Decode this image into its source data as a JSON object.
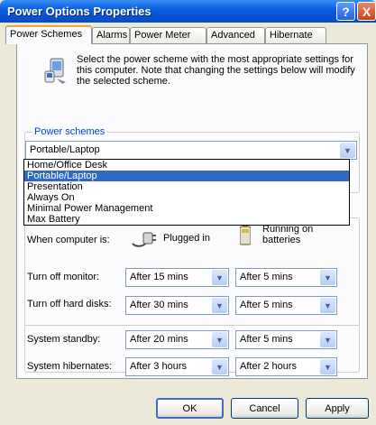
{
  "window": {
    "title": "Power Options Properties",
    "help_label": "?",
    "close_label": "X"
  },
  "tabs": [
    {
      "label": "Power Schemes"
    },
    {
      "label": "Alarms"
    },
    {
      "label": "Power Meter"
    },
    {
      "label": "Advanced"
    },
    {
      "label": "Hibernate"
    }
  ],
  "intro": {
    "text": "Select the power scheme with the most appropriate settings for this computer. Note that changing the settings below will modify the selected scheme."
  },
  "schemes": {
    "group_label": "Power schemes",
    "selected": "Portable/Laptop",
    "options": [
      "Home/Office Desk",
      "Portable/Laptop",
      "Presentation",
      "Always On",
      "Minimal Power Management",
      "Max Battery"
    ]
  },
  "settings": {
    "when_label": "When computer is:",
    "plugged_label": "Plugged in",
    "battery_label_1": "Running on",
    "battery_label_2": "batteries",
    "rows": [
      {
        "label": "Turn off monitor:",
        "plugged": "After 15 mins",
        "battery": "After 5 mins"
      },
      {
        "label": "Turn off hard disks:",
        "plugged": "After 30 mins",
        "battery": "After 5 mins"
      },
      {
        "label": "System standby:",
        "plugged": "After 20 mins",
        "battery": "After 5 mins"
      },
      {
        "label": "System hibernates:",
        "plugged": "After 3 hours",
        "battery": "After 2 hours"
      }
    ]
  },
  "buttons": {
    "ok": "OK",
    "cancel": "Cancel",
    "apply": "Apply"
  },
  "icons": {
    "dropdown_arrow": "chevron-down-icon",
    "scheme": "power-scheme-icon",
    "plugged": "power-plug-icon",
    "battery": "battery-icon"
  }
}
